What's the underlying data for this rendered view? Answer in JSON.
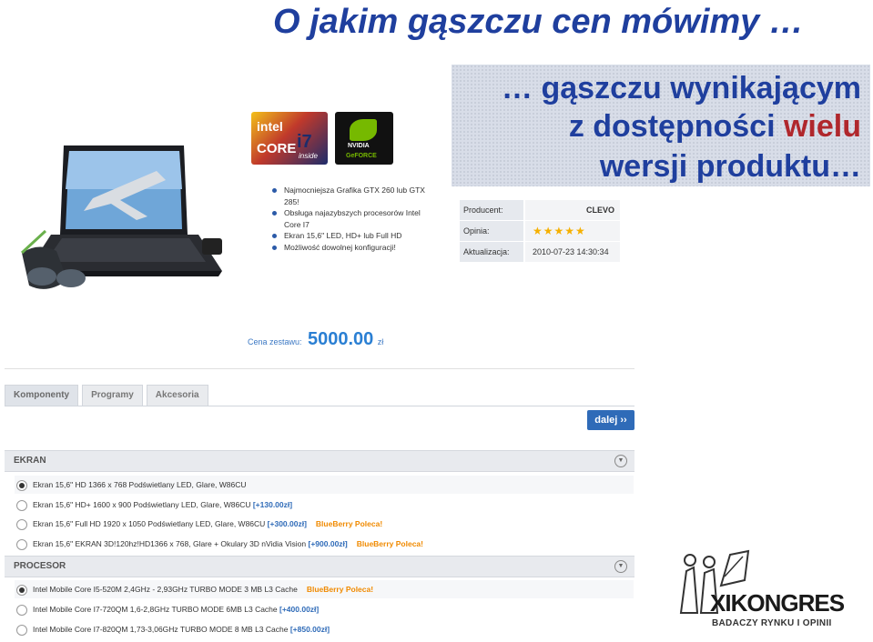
{
  "slide": {
    "title": "O jakim gąszczu cen mówimy …",
    "callout": {
      "line1": "… gąszczu wynikającym",
      "line2_a": "z dostępności ",
      "line2_b": "wielu",
      "line3": "wersji produktu…"
    }
  },
  "product": {
    "badges": {
      "intel_line1": "intel",
      "intel_line2": "CORE",
      "intel_model": "i7",
      "intel_inside": "inside",
      "nvidia_line1": "NVIDIA",
      "nvidia_line2": "GeFORCE"
    },
    "features": [
      "Najmocniejsza Grafika GTX 260 lub GTX 285!",
      "Obsługa najazybszych procesorów Intel Core I7",
      "Ekran 15,6\" LED, HD+ lub Full HD",
      "Możliwość dowolnej konfiguracji!"
    ],
    "info": {
      "producer_label": "Producent:",
      "producer_value": "CLEVO",
      "rating_label": "Opinia:",
      "rating_stars": "★★★★★",
      "updated_label": "Aktualizacja:",
      "updated_value": "2010-07-23 14:30:34"
    },
    "price": {
      "label": "Cena zestawu:",
      "value": "5000.00",
      "currency": "zł"
    }
  },
  "tabs": [
    {
      "label": "Komponenty"
    },
    {
      "label": "Programy"
    },
    {
      "label": "Akcesoria"
    }
  ],
  "next_button": "dalej ››",
  "sections": [
    {
      "title": "EKRAN",
      "options": [
        {
          "text": "Ekran 15,6\" HD 1366 x 768 Podświetlany LED, Glare, W86CU",
          "extra": "",
          "poleca": "",
          "selected": true
        },
        {
          "text": "Ekran 15,6\" HD+ 1600 x 900 Podświetlany LED, Glare, W86CU ",
          "extra": "[+130.00zł]",
          "poleca": "",
          "selected": false
        },
        {
          "text": "Ekran 15,6\" Full HD 1920 x 1050 Podświetlany LED, Glare, W86CU ",
          "extra": "[+300.00zł]",
          "poleca": "BlueBerry Poleca!",
          "selected": false
        },
        {
          "text": "Ekran 15,6\" EKRAN 3D!120hz!HD1366 x 768, Glare + Okulary 3D nVidia Vision ",
          "extra": "[+900.00zł]",
          "poleca": "BlueBerry Poleca!",
          "selected": false
        }
      ]
    },
    {
      "title": "PROCESOR",
      "options": [
        {
          "text": "Intel Mobile Core I5-520M 2,4GHz - 2,93GHz TURBO MODE 3 MB L3 Cache",
          "extra": "",
          "poleca": "BlueBerry Poleca!",
          "selected": true
        },
        {
          "text": "Intel Mobile Core I7-720QM 1,6-2,8GHz TURBO MODE 6MB L3 Cache ",
          "extra": "[+400.00zł]",
          "poleca": "",
          "selected": false
        },
        {
          "text": "Intel Mobile Core I7-820QM 1,73-3,06GHz TURBO MODE 8 MB L3 Cache ",
          "extra": "[+850.00zł]",
          "poleca": "",
          "selected": false
        }
      ]
    }
  ],
  "logo": {
    "xi": "XI",
    "kongres": "KONGRES",
    "subtitle": "BADACZY RYNKU I OPINII"
  }
}
